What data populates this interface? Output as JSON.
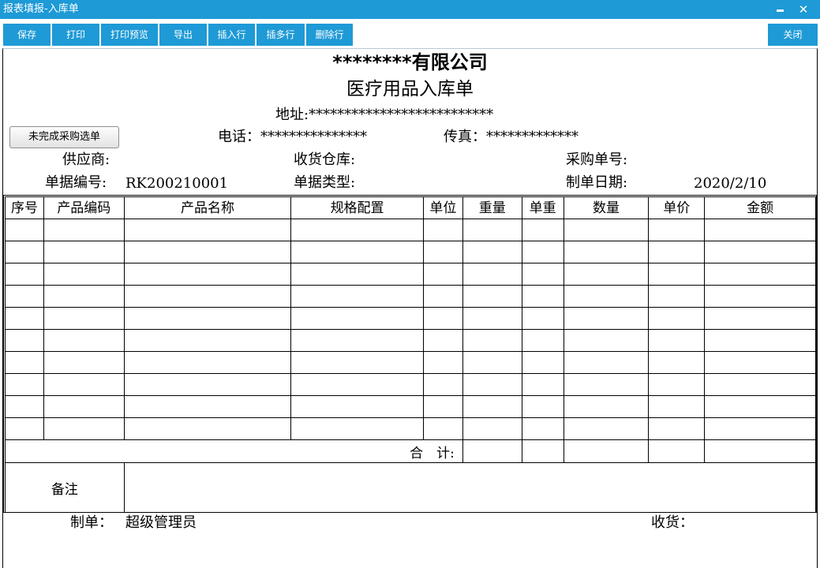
{
  "window": {
    "title": "报表填报-入库单",
    "minimize_label": "",
    "close_label": "✕"
  },
  "toolbar": {
    "buttons": [
      "保存",
      "打印",
      "打印预览",
      "导出",
      "插入行",
      "插多行",
      "删除行"
    ],
    "close_label": "关闭"
  },
  "header": {
    "company": "********有限公司",
    "doc_title": "医疗用品入库单",
    "address": "地址:**************************",
    "phone": "电话：***************",
    "fax": "传真：*************",
    "pending_po_button": "未完成采购选单",
    "supplier_label": "供应商:",
    "warehouse_label": "收货仓库:",
    "po_number_label": "采购单号:",
    "doc_number_label": "单据编号:",
    "doc_number_value": "RK200210001",
    "doc_type_label": "单据类型:",
    "date_label": "制单日期:",
    "date_value": "2020/2/10"
  },
  "table": {
    "columns": [
      "序号",
      "产品编码",
      "产品名称",
      "规格配置",
      "单位",
      "重量",
      "单重",
      "数量",
      "单价",
      "金额"
    ],
    "rows": [
      [
        "",
        "",
        "",
        "",
        "",
        "",
        "",
        "",
        "",
        ""
      ],
      [
        "",
        "",
        "",
        "",
        "",
        "",
        "",
        "",
        "",
        ""
      ],
      [
        "",
        "",
        "",
        "",
        "",
        "",
        "",
        "",
        "",
        ""
      ],
      [
        "",
        "",
        "",
        "",
        "",
        "",
        "",
        "",
        "",
        ""
      ],
      [
        "",
        "",
        "",
        "",
        "",
        "",
        "",
        "",
        "",
        ""
      ],
      [
        "",
        "",
        "",
        "",
        "",
        "",
        "",
        "",
        "",
        ""
      ],
      [
        "",
        "",
        "",
        "",
        "",
        "",
        "",
        "",
        "",
        ""
      ],
      [
        "",
        "",
        "",
        "",
        "",
        "",
        "",
        "",
        "",
        ""
      ],
      [
        "",
        "",
        "",
        "",
        "",
        "",
        "",
        "",
        "",
        ""
      ],
      [
        "",
        "",
        "",
        "",
        "",
        "",
        "",
        "",
        "",
        ""
      ]
    ],
    "total_label": "合　计:",
    "remark_label": "备注"
  },
  "footer": {
    "maker_label": "制单：",
    "maker_value": "超级管理员",
    "receiver_label": "收货："
  }
}
